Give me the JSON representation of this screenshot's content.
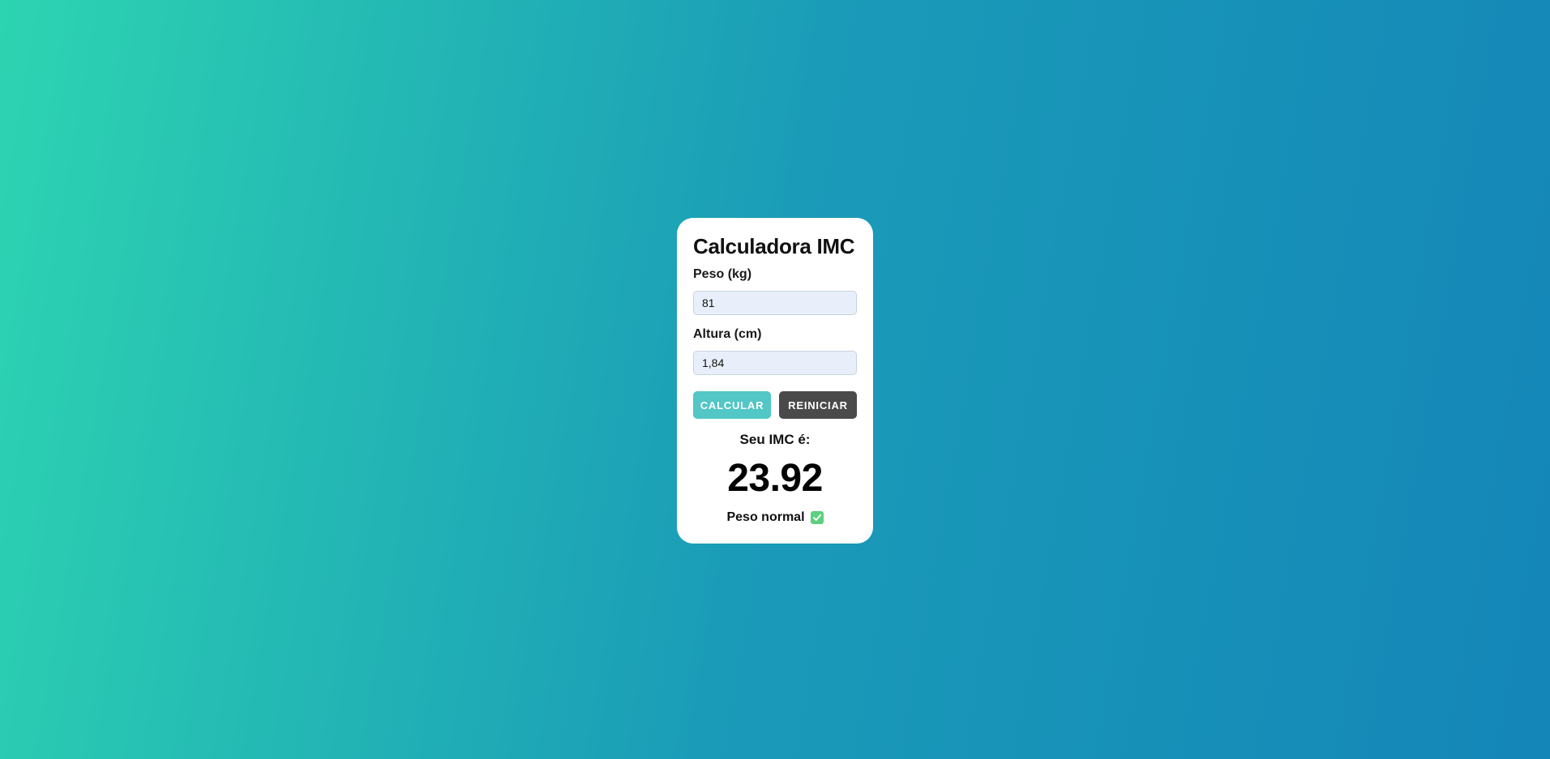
{
  "calculator": {
    "title": "Calculadora IMC",
    "weight_label": "Peso (kg)",
    "weight_value": "81",
    "height_label": "Altura (cm)",
    "height_value": "1,84",
    "calculate_label": "CALCULAR",
    "reset_label": "REINICIAR"
  },
  "result": {
    "label": "Seu IMC é:",
    "value": "23.92",
    "status": "Peso normal",
    "status_icon": "check-mark-icon"
  },
  "colors": {
    "background_gradient_start": "#2dd4b1",
    "background_gradient_end": "#1486b8",
    "calculate_button": "#53c6c6",
    "reset_button": "#4a4a4a",
    "input_background": "#e8effb",
    "check_icon": "#5fcf80"
  }
}
